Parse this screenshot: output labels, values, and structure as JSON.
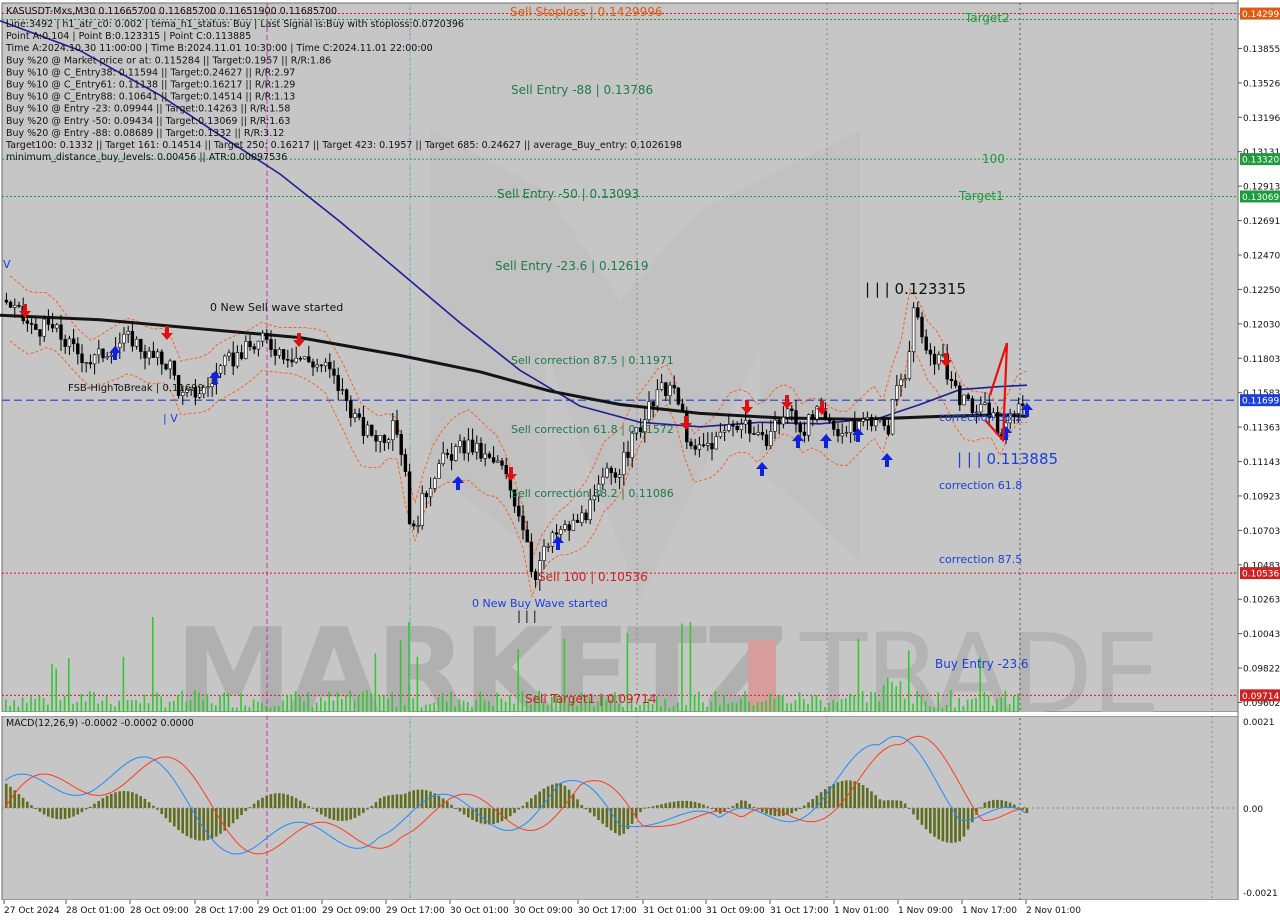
{
  "header": {
    "title": "KASUSDT-Mxs,M30 0.11665700 0.11685700 0.11651900 0.11685700",
    "info_lines": [
      "Line:3492 | h1_atr_c0: 0.002 | tema_h1_status: Buy | Last Signal is:Buy with stoploss:0.0720396",
      "Point A:0.104 | Point B:0.123315 | Point C:0.113885",
      "Time A:2024.10.30 11:00:00 | Time B:2024.11.01 10:30:00 | Time C:2024.11.01 22:00:00",
      "Buy %20 @ Market price or at: 0.115284 || Target:0.1957 || R/R:1.86",
      "Buy %10 @ C_Entry38: 0.11594 || Target:0.24627 || R/R:2.97",
      "Buy %10 @ C_Entry61: 0.11138 || Target:0.16217 || R/R:1.29",
      "Buy %10 @ C_Entry88: 0.10641 || Target:0.14514 || R/R:1.13",
      "Buy %10 @ Entry -23: 0.09944 || Target:0.14263 || R/R:1.58",
      "Buy %20 @ Entry -50: 0.09434 || Target:0.13069 || R/R:1.63",
      "Buy %20 @ Entry -88: 0.08689 || Target:0.1332 || R/R:3.12",
      "Target100: 0.1332 || Target 161: 0.14514 || Target 250: 0.16217 || Target 423: 0.1957 || Target 685: 0.24627 || average_Buy_entry: 0.1026198",
      "minimum_distance_buy_levels: 0.00456 || ATR:0.00097536"
    ]
  },
  "watermark": {
    "left": "MARKETZ",
    "right": "TRADE"
  },
  "chart_data": [
    {
      "type": "candlestick",
      "symbol": "KASUSDT-Mxs",
      "timeframe": "M30",
      "ylim": [
        0.09602,
        0.1437
      ],
      "price_axis_ticks": [
        "0.14185",
        "0.13855",
        "0.13526",
        "0.13196",
        "0.13131",
        "0.12913",
        "0.12691",
        "0.12470",
        "0.12250",
        "0.12030",
        "0.11803",
        "0.11583",
        "0.11363",
        "0.11143",
        "0.10923",
        "0.10703",
        "0.10483",
        "0.10263",
        "0.10043",
        "0.09822",
        "0.09602"
      ],
      "price_tags": [
        {
          "label": "0.14299",
          "value": 0.14299,
          "color": "#e05a10"
        },
        {
          "label": "0.13320",
          "value": 0.1332,
          "color": "#1e9b3c"
        },
        {
          "label": "0.13069",
          "value": 0.13069,
          "color": "#1e9b3c"
        },
        {
          "label": "0.11699",
          "value": 0.11699,
          "color": "#1c3fd8"
        },
        {
          "label": "0.10536",
          "value": 0.10536,
          "color": "#cc2222"
        },
        {
          "label": "0.09714",
          "value": 0.09714,
          "color": "#cc2222"
        }
      ],
      "horizontal_levels": [
        {
          "value": 0.14299,
          "color": "#cc2222",
          "style": "dotted"
        },
        {
          "value": 0.14259,
          "color": "#1e9b3c",
          "style": "dotted"
        },
        {
          "value": 0.1332,
          "color": "#1e9b3c",
          "style": "dotted"
        },
        {
          "value": 0.13069,
          "color": "#1e9b3c",
          "style": "dotted"
        },
        {
          "value": 0.11699,
          "color": "#1c3fd8",
          "style": "dashed"
        },
        {
          "value": 0.10536,
          "color": "#cc2222",
          "style": "dotted"
        },
        {
          "value": 0.09714,
          "color": "#cc2222",
          "style": "dotted"
        }
      ],
      "level_labels": [
        {
          "text": "Sell Stoploss | 0.1429996",
          "color": "#e05a10"
        },
        {
          "text": "Target2",
          "color": "#1e9b3c"
        },
        {
          "text": "Sell Entry -88 | 0.13786",
          "color": "#1e7a4a"
        },
        {
          "text": "100",
          "color": "#1e9b3c"
        },
        {
          "text": "Sell Entry -50 | 0.13093",
          "color": "#1e7a4a"
        },
        {
          "text": "Target1",
          "color": "#1e9b3c"
        },
        {
          "text": "Sell Entry -23.6 | 0.12619",
          "color": "#1e7a4a"
        },
        {
          "text": "| | | 0.123315",
          "color": "#111111"
        },
        {
          "text": "0 New Sell wave started",
          "color": "#111111"
        },
        {
          "text": "Sell correction 87.5 | 0.11971",
          "color": "#1e7a4a"
        },
        {
          "text": "FSB-HighToBreak | 0.11699",
          "color": "#111111"
        },
        {
          "text": "Sell correction 61.8 | 0.11572",
          "color": "#1e7a4a"
        },
        {
          "text": "correction 38.2",
          "color": "#1c3fd8"
        },
        {
          "text": "| | | 0.113885",
          "color": "#1c3fd8"
        },
        {
          "text": "correction 61.8",
          "color": "#1c3fd8"
        },
        {
          "text": "Sell correction 38.2 | 0.11086",
          "color": "#1e7a4a"
        },
        {
          "text": "correction 87.5",
          "color": "#1c3fd8"
        },
        {
          "text": "Sell 100 | 0.10536",
          "color": "#cc2222"
        },
        {
          "text": "0 New Buy Wave started",
          "color": "#1c3fd8"
        },
        {
          "text": "Buy Entry -23.6",
          "color": "#1c3fd8"
        },
        {
          "text": "Sell Target1 | 0.09714",
          "color": "#cc2222"
        },
        {
          "text": "| V",
          "color": "#1c3fd8"
        },
        {
          "text": "| | |",
          "color": "#111111"
        },
        {
          "text": "V",
          "color": "#1c3fd8"
        }
      ],
      "price_path": [
        [
          0,
          0.124
        ],
        [
          14,
          0.123
        ],
        [
          30,
          0.1218
        ],
        [
          50,
          0.1219
        ],
        [
          70,
          0.1205
        ],
        [
          90,
          0.1196
        ],
        [
          110,
          0.1206
        ],
        [
          130,
          0.1212
        ],
        [
          150,
          0.1198
        ],
        [
          168,
          0.1195
        ],
        [
          180,
          0.1172
        ],
        [
          190,
          0.1174
        ],
        [
          205,
          0.1178
        ],
        [
          220,
          0.1192
        ],
        [
          240,
          0.1202
        ],
        [
          262,
          0.121
        ],
        [
          280,
          0.1203
        ],
        [
          300,
          0.1198
        ],
        [
          325,
          0.1192
        ],
        [
          345,
          0.117
        ],
        [
          360,
          0.115
        ],
        [
          380,
          0.1145
        ],
        [
          395,
          0.1152
        ],
        [
          405,
          0.112
        ],
        [
          410,
          0.1075
        ],
        [
          420,
          0.11
        ],
        [
          435,
          0.1125
        ],
        [
          452,
          0.1135
        ],
        [
          468,
          0.114
        ],
        [
          485,
          0.113
        ],
        [
          500,
          0.1125
        ],
        [
          515,
          0.11
        ],
        [
          525,
          0.108
        ],
        [
          532,
          0.105
        ],
        [
          540,
          0.1065
        ],
        [
          555,
          0.108
        ],
        [
          570,
          0.1085
        ],
        [
          590,
          0.1098
        ],
        [
          605,
          0.112
        ],
        [
          620,
          0.1125
        ],
        [
          632,
          0.1145
        ],
        [
          645,
          0.116
        ],
        [
          658,
          0.1175
        ],
        [
          668,
          0.118
        ],
        [
          680,
          0.1163
        ],
        [
          690,
          0.1133
        ],
        [
          700,
          0.1138
        ],
        [
          715,
          0.1143
        ],
        [
          730,
          0.1155
        ],
        [
          745,
          0.1155
        ],
        [
          760,
          0.114
        ],
        [
          775,
          0.1155
        ],
        [
          790,
          0.1163
        ],
        [
          800,
          0.115
        ],
        [
          815,
          0.116
        ],
        [
          830,
          0.1153
        ],
        [
          845,
          0.1148
        ],
        [
          860,
          0.1155
        ],
        [
          875,
          0.116
        ],
        [
          885,
          0.1145
        ],
        [
          895,
          0.118
        ],
        [
          905,
          0.119
        ],
        [
          912,
          0.1233
        ],
        [
          922,
          0.1205
        ],
        [
          932,
          0.12
        ],
        [
          942,
          0.1195
        ],
        [
          952,
          0.118
        ],
        [
          962,
          0.1168
        ],
        [
          975,
          0.1163
        ],
        [
          990,
          0.1163
        ],
        [
          998,
          0.1145
        ],
        [
          1005,
          0.115
        ],
        [
          1012,
          0.1165
        ],
        [
          1020,
          0.1168
        ],
        [
          1027,
          0.1168
        ]
      ],
      "black_ma_path": [
        [
          0,
          0.1227
        ],
        [
          100,
          0.1224
        ],
        [
          200,
          0.1218
        ],
        [
          300,
          0.1212
        ],
        [
          400,
          0.12
        ],
        [
          480,
          0.1189
        ],
        [
          550,
          0.1176
        ],
        [
          620,
          0.1167
        ],
        [
          700,
          0.1161
        ],
        [
          780,
          0.1158
        ],
        [
          860,
          0.1157
        ],
        [
          940,
          0.1159
        ],
        [
          1000,
          0.116
        ],
        [
          1027,
          0.1159
        ]
      ],
      "blue_ma_path": [
        [
          0,
          0.1425
        ],
        [
          80,
          0.1405
        ],
        [
          160,
          0.1375
        ],
        [
          220,
          0.1348
        ],
        [
          280,
          0.1322
        ],
        [
          340,
          0.129
        ],
        [
          400,
          0.1256
        ],
        [
          460,
          0.1222
        ],
        [
          520,
          0.119
        ],
        [
          580,
          0.1166
        ],
        [
          640,
          0.1155
        ],
        [
          700,
          0.1152
        ],
        [
          760,
          0.1155
        ],
        [
          820,
          0.1154
        ],
        [
          880,
          0.1158
        ],
        [
          920,
          0.1167
        ],
        [
          960,
          0.1177
        ],
        [
          1000,
          0.1179
        ],
        [
          1027,
          0.118
        ]
      ],
      "x_axis_labels": [
        "27 Oct 2024",
        "28 Oct 01:00",
        "28 Oct 09:00",
        "28 Oct 17:00",
        "29 Oct 01:00",
        "29 Oct 09:00",
        "29 Oct 17:00",
        "30 Oct 01:00",
        "30 Oct 09:00",
        "30 Oct 17:00",
        "31 Oct 01:00",
        "31 Oct 09:00",
        "31 Oct 17:00",
        "1 Nov 01:00",
        "1 Nov 09:00",
        "1 Nov 17:00",
        "2 Nov 01:00"
      ]
    },
    {
      "type": "macd",
      "title": "MACD(12,26,9) -0.0002 -0.0002 0.0000",
      "ylim": [
        -0.0021,
        0.0021
      ],
      "axis_ticks": [
        "0.0021",
        "0.00",
        "-0.0021"
      ]
    }
  ]
}
